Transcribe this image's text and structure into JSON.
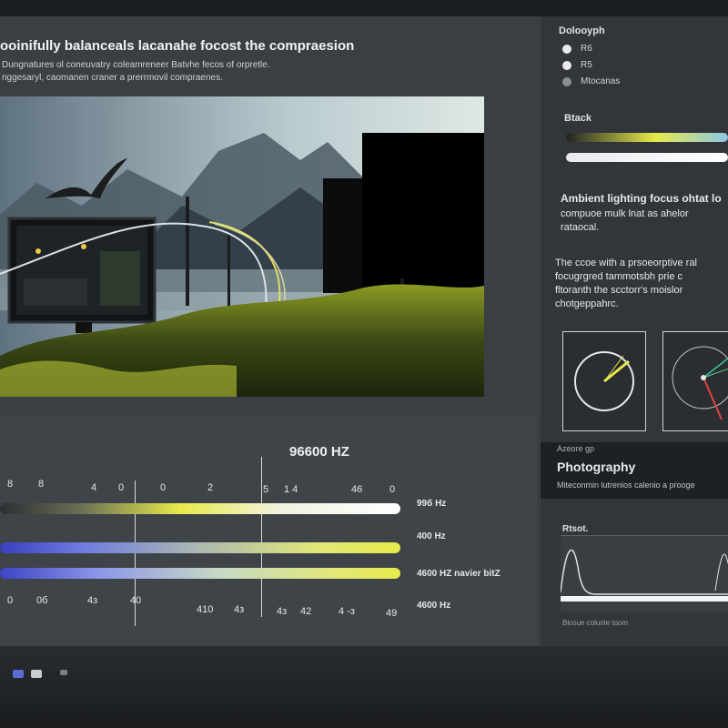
{
  "headline": "ooinifully balanceals lacanahe focost the compraesion",
  "sub1": "Dungnatures ol coneuvatry coleamreneer Batvhe fecos of orpretle.",
  "sub2": "nggesaryl, caomanen craner a prerrmovil compraenes.",
  "frequency": {
    "title": "96600 HZ",
    "ticks_top": [
      "8",
      "8",
      "4",
      "0",
      "0",
      "2",
      "5",
      "1 4",
      "46",
      "0"
    ],
    "ticks_bottom": [
      "0",
      "0б",
      "4з",
      "40",
      "410",
      "4з",
      "4з",
      "42",
      "4 -з",
      "49"
    ],
    "bar_labels": [
      "99б Hz",
      "400 Hz",
      "4600 HZ navier bitZ",
      "4600 Hz"
    ]
  },
  "right_panel": {
    "section1_title": "Dolooyph",
    "radio_labels": [
      "R6",
      "R5",
      "Mtocanas"
    ],
    "section2_title": "Btack",
    "ambient_title": "Ambient lighting focus  ohtat lo",
    "ambient_lines": [
      "compuoe mulk lnat as ahelor",
      "rataocal."
    ],
    "desc_lines": [
      "The ccoe with a prsoeorptive ral",
      "focugrgred tammotsbh prie c",
      "fltoranth the scctorr's moislor",
      "chotgeppahrc."
    ],
    "photo_small": "Azeore gp",
    "photo_title": "Photography",
    "photo_sub": "Miteconmin lutrenios calenio a prooge",
    "mini_chart_title": "Rtsot.",
    "footer_text": "Blcoue colunle toom"
  },
  "colors": {
    "accent_yellow": "#e7ea4a",
    "accent_blue": "#6b6be8",
    "panel_dark": "#32363a"
  }
}
